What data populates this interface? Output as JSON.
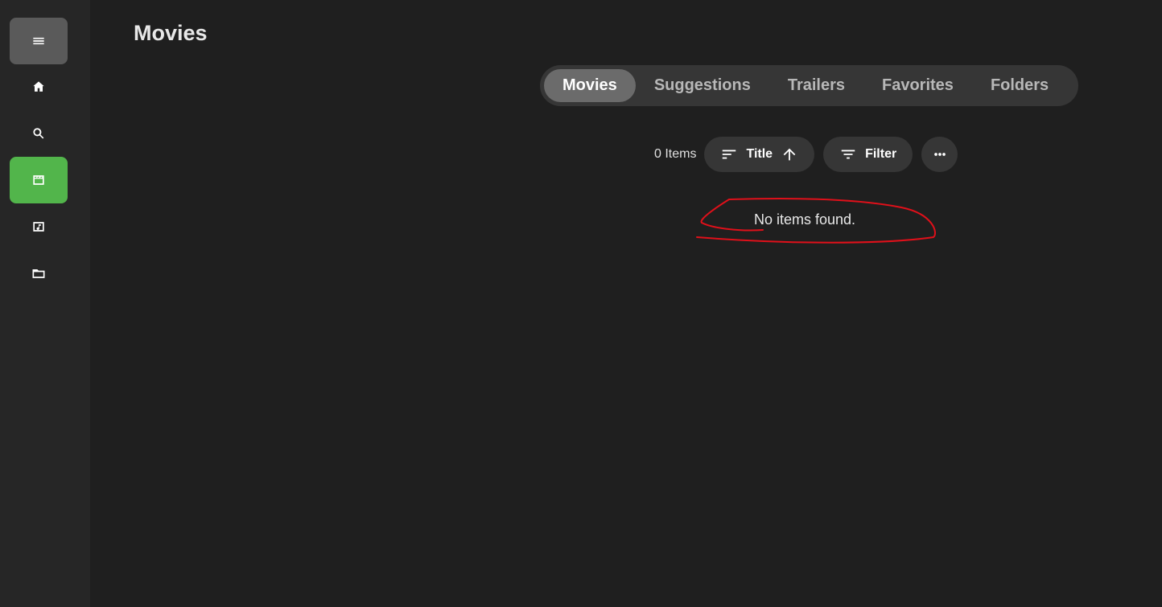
{
  "header": {
    "title": "Movies"
  },
  "sidebar": {
    "items": [
      {
        "name": "menu",
        "icon": "hamburger-icon"
      },
      {
        "name": "home",
        "icon": "home-icon"
      },
      {
        "name": "search",
        "icon": "search-icon"
      },
      {
        "name": "movies",
        "icon": "movie-icon",
        "active": true
      },
      {
        "name": "music",
        "icon": "music-icon"
      },
      {
        "name": "folders",
        "icon": "folder-icon"
      }
    ]
  },
  "tabs": [
    {
      "label": "Movies",
      "active": true
    },
    {
      "label": "Suggestions"
    },
    {
      "label": "Trailers"
    },
    {
      "label": "Favorites"
    },
    {
      "label": "Folders"
    }
  ],
  "toolbar": {
    "item_count": "0 Items",
    "sort_label": "Title",
    "filter_label": "Filter"
  },
  "content": {
    "empty_message": "No items found."
  },
  "colors": {
    "accent": "#52b54b",
    "background": "#1f1f1f",
    "sidebar": "#262626",
    "annotation": "#e0101a"
  }
}
